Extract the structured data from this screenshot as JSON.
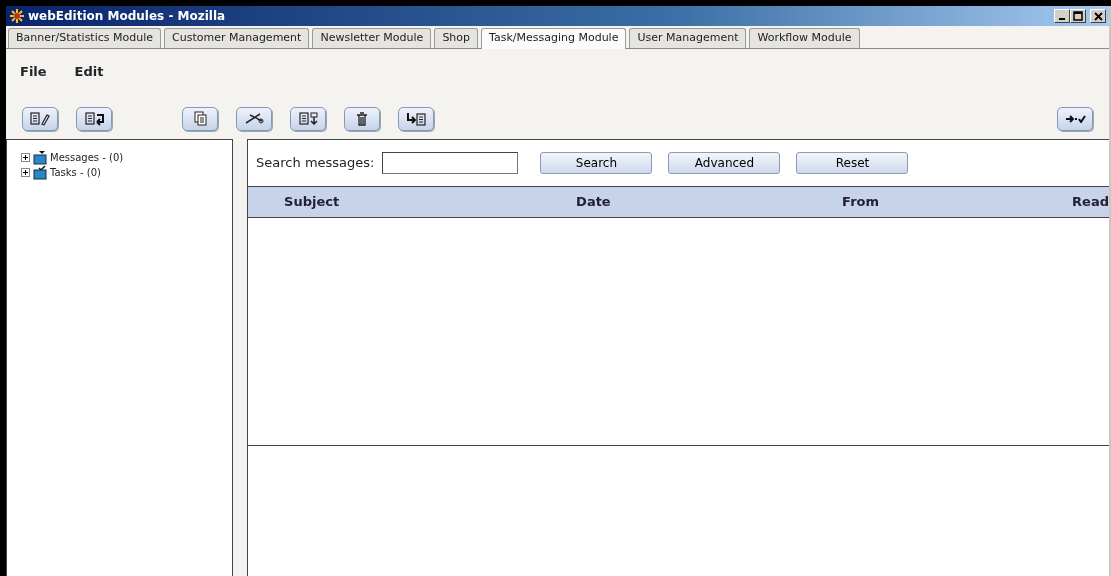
{
  "window": {
    "title": "webEdition Modules - Mozilla"
  },
  "tabs": [
    {
      "label": "Banner/Statistics Module",
      "selected": false
    },
    {
      "label": "Customer Management",
      "selected": false
    },
    {
      "label": "Newsletter Module",
      "selected": false
    },
    {
      "label": "Shop",
      "selected": false
    },
    {
      "label": "Task/Messaging Module",
      "selected": true
    },
    {
      "label": "User Management",
      "selected": false
    },
    {
      "label": "Workflow Module",
      "selected": false
    }
  ],
  "menu": [
    "File",
    "Edit"
  ],
  "tree": [
    {
      "label": "Messages - (0)",
      "expanded": false,
      "kind": "messages"
    },
    {
      "label": "Tasks - (0)",
      "expanded": false,
      "kind": "tasks"
    }
  ],
  "search": {
    "label": "Search messages:",
    "buttons": [
      "Search",
      "Advanced",
      "Reset"
    ]
  },
  "table": {
    "columns": [
      "Subject",
      "Date",
      "From",
      "Read"
    ]
  }
}
